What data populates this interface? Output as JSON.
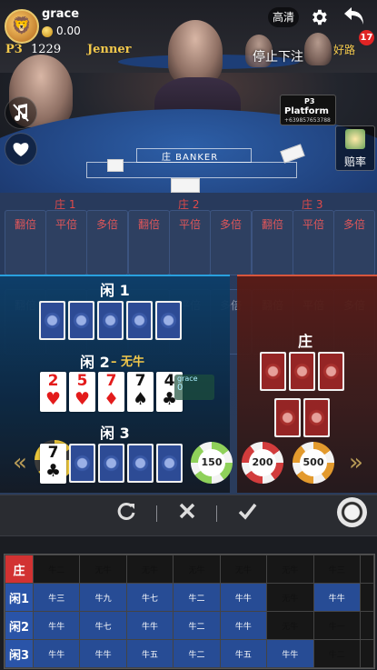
{
  "user": {
    "name": "grace",
    "balance": "0.00",
    "avatar_icon": "avatar-icon"
  },
  "room": {
    "code": "P3",
    "value": "1229",
    "dealer": "Jenner"
  },
  "header": {
    "quality_label": "高清",
    "status_text": "停止下注",
    "roadmap_label": "好路",
    "notification_count": "17"
  },
  "stream": {
    "table_text": "庄 BANKER",
    "platform_sign": {
      "line1": "P3",
      "line2": "Platform",
      "line3": "+639857653788"
    },
    "odds_label": "赔率"
  },
  "bet_groups": [
    {
      "title": "庄 1",
      "options": [
        "翻倍",
        "平倍",
        "多倍"
      ]
    },
    {
      "title": "庄 2",
      "options": [
        "翻倍",
        "平倍",
        "多倍"
      ]
    },
    {
      "title": "庄 3",
      "options": [
        "翻倍",
        "平倍",
        "多倍"
      ]
    }
  ],
  "bet_groups_row2": [
    "翻倍",
    "平倍",
    "多倍",
    "翻倍",
    "平倍",
    "多倍",
    "翻倍",
    "平倍",
    "多倍"
  ],
  "hands": {
    "player1": {
      "title": "闲 1"
    },
    "player2": {
      "title": "闲 2",
      "separator": "–",
      "result": "无牛",
      "cards": [
        {
          "rank": "2",
          "suit": "♥",
          "color": "#e31b1b"
        },
        {
          "rank": "5",
          "suit": "♥",
          "color": "#e31b1b"
        },
        {
          "rank": "7",
          "suit": "♦",
          "color": "#e31b1b"
        },
        {
          "rank": "7",
          "suit": "♠",
          "color": "#111111"
        },
        {
          "rank": "4",
          "suit": "♣",
          "color": "#111111"
        }
      ]
    },
    "player3": {
      "title": "闲 3",
      "first_card": {
        "rank": "7",
        "suit": "♣",
        "color": "#111111"
      }
    },
    "banker": {
      "title": "庄"
    }
  },
  "player_tag": {
    "name": "grace",
    "amount": "0"
  },
  "chips": [
    {
      "value": "150",
      "color": "#8fd15a"
    },
    {
      "value": "200",
      "color": "#d23c3c"
    },
    {
      "value": "500",
      "color": "#e39a2d"
    }
  ],
  "actions": {
    "repeat_icon": "refresh-icon",
    "cancel_icon": "close-icon",
    "confirm_icon": "check-icon"
  },
  "results": {
    "rows": [
      {
        "label": "庄",
        "cells": [
          "牛二",
          "无牛",
          "无牛",
          "无牛",
          "无牛",
          "无牛",
          "牛三",
          ""
        ]
      },
      {
        "label": "闲1",
        "cells": [
          "牛三",
          "牛九",
          "牛七",
          "牛二",
          "牛牛",
          "无牛",
          "牛牛",
          ""
        ]
      },
      {
        "label": "闲2",
        "cells": [
          "牛牛",
          "牛七",
          "牛牛",
          "牛二",
          "牛牛",
          "无牛",
          "牛一",
          ""
        ]
      },
      {
        "label": "闲3",
        "cells": [
          "牛牛",
          "牛牛",
          "牛五",
          "牛二",
          "牛五",
          "牛牛",
          "牛二",
          ""
        ]
      }
    ],
    "highlight": [
      [
        0,
        0,
        0,
        0,
        0,
        0,
        0,
        0
      ],
      [
        1,
        1,
        1,
        1,
        1,
        0,
        1,
        0
      ],
      [
        1,
        1,
        1,
        1,
        1,
        0,
        0,
        0
      ],
      [
        1,
        1,
        1,
        1,
        1,
        1,
        0,
        0
      ]
    ]
  }
}
